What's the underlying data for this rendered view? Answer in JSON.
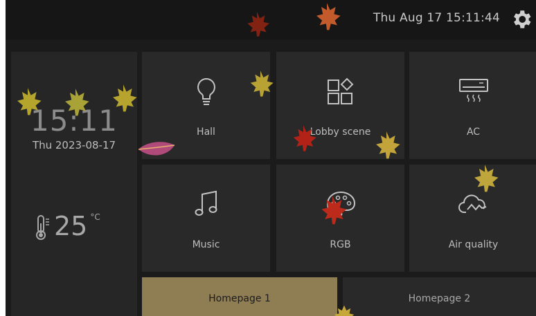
{
  "status_bar": {
    "datetime": "Thu Aug 17  15:11:44",
    "settings_icon": "gear-icon"
  },
  "info_panel": {
    "time": "15:11",
    "date": "Thu 2023-08-17",
    "temperature": "25",
    "temperature_unit": "°C",
    "thermometer_icon": "thermometer-icon"
  },
  "tiles": [
    {
      "label": "Hall",
      "icon": "light-bulb-icon"
    },
    {
      "label": "Lobby scene",
      "icon": "scene-grid-icon"
    },
    {
      "label": "AC",
      "icon": "air-conditioner-icon"
    },
    {
      "label": "Music",
      "icon": "music-note-icon"
    },
    {
      "label": "RGB",
      "icon": "palette-icon"
    },
    {
      "label": "Air quality",
      "icon": "cloud-wind-icon"
    }
  ],
  "pages": [
    {
      "label": "Homepage 1",
      "active": true
    },
    {
      "label": "Homepage 2",
      "active": false
    }
  ],
  "colors": {
    "background": "#1b1b1b",
    "tile": "#292929",
    "active_tab": "#8f7d54",
    "text": "#bdbdbd"
  }
}
